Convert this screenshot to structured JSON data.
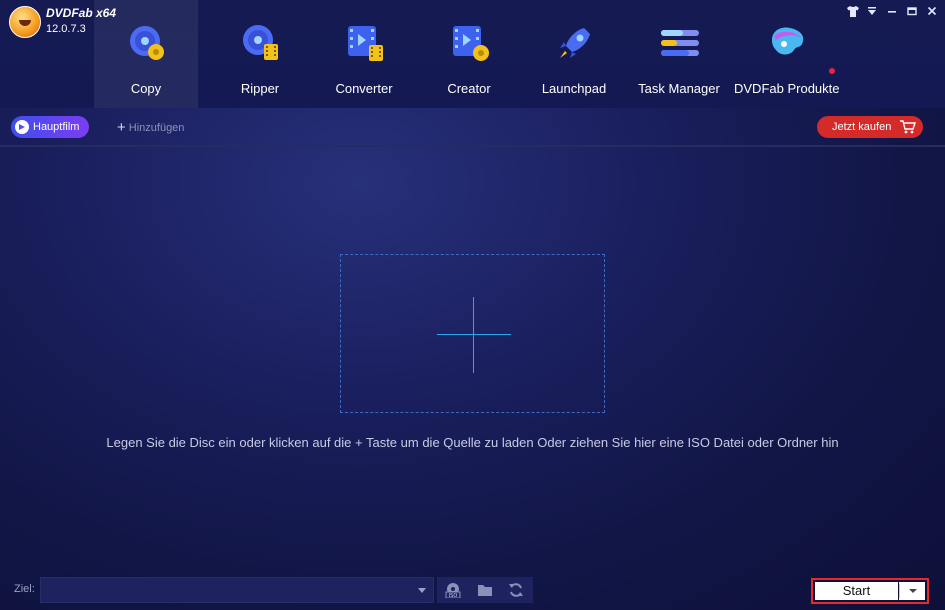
{
  "app": {
    "name": "DVDFab x64",
    "version": "12.0.7.3"
  },
  "window_controls": [
    "shirt-icon",
    "dropdown-icon",
    "minimize-icon",
    "maximize-icon",
    "close-icon"
  ],
  "nav": [
    {
      "label": "Copy",
      "icon": "disc-copy-icon",
      "active": true
    },
    {
      "label": "Ripper",
      "icon": "disc-ripper-icon",
      "active": false
    },
    {
      "label": "Converter",
      "icon": "film-converter-icon",
      "active": false
    },
    {
      "label": "Creator",
      "icon": "film-creator-icon",
      "active": false
    },
    {
      "label": "Launchpad",
      "icon": "rocket-icon",
      "active": false
    },
    {
      "label": "Task Manager",
      "icon": "task-list-icon",
      "active": false
    },
    {
      "label": "DVDFab Produkte",
      "icon": "products-icon",
      "active": false
    }
  ],
  "toolbar": {
    "main_movie_label": "Hauptfilm",
    "add_label": "Hinzufügen",
    "buy_label": "Jetzt kaufen"
  },
  "drop": {
    "hint": "Legen Sie die Disc ein oder klicken auf die + Taste um die Quelle zu laden Oder ziehen Sie hier eine ISO Datei oder Ordner hin"
  },
  "footer": {
    "target_label": "Ziel:",
    "target_value": "",
    "start_label": "Start"
  },
  "colors": {
    "accent": "#2aa7e8",
    "buy": "#d52a2a",
    "start_outline": "#e52a2a"
  }
}
